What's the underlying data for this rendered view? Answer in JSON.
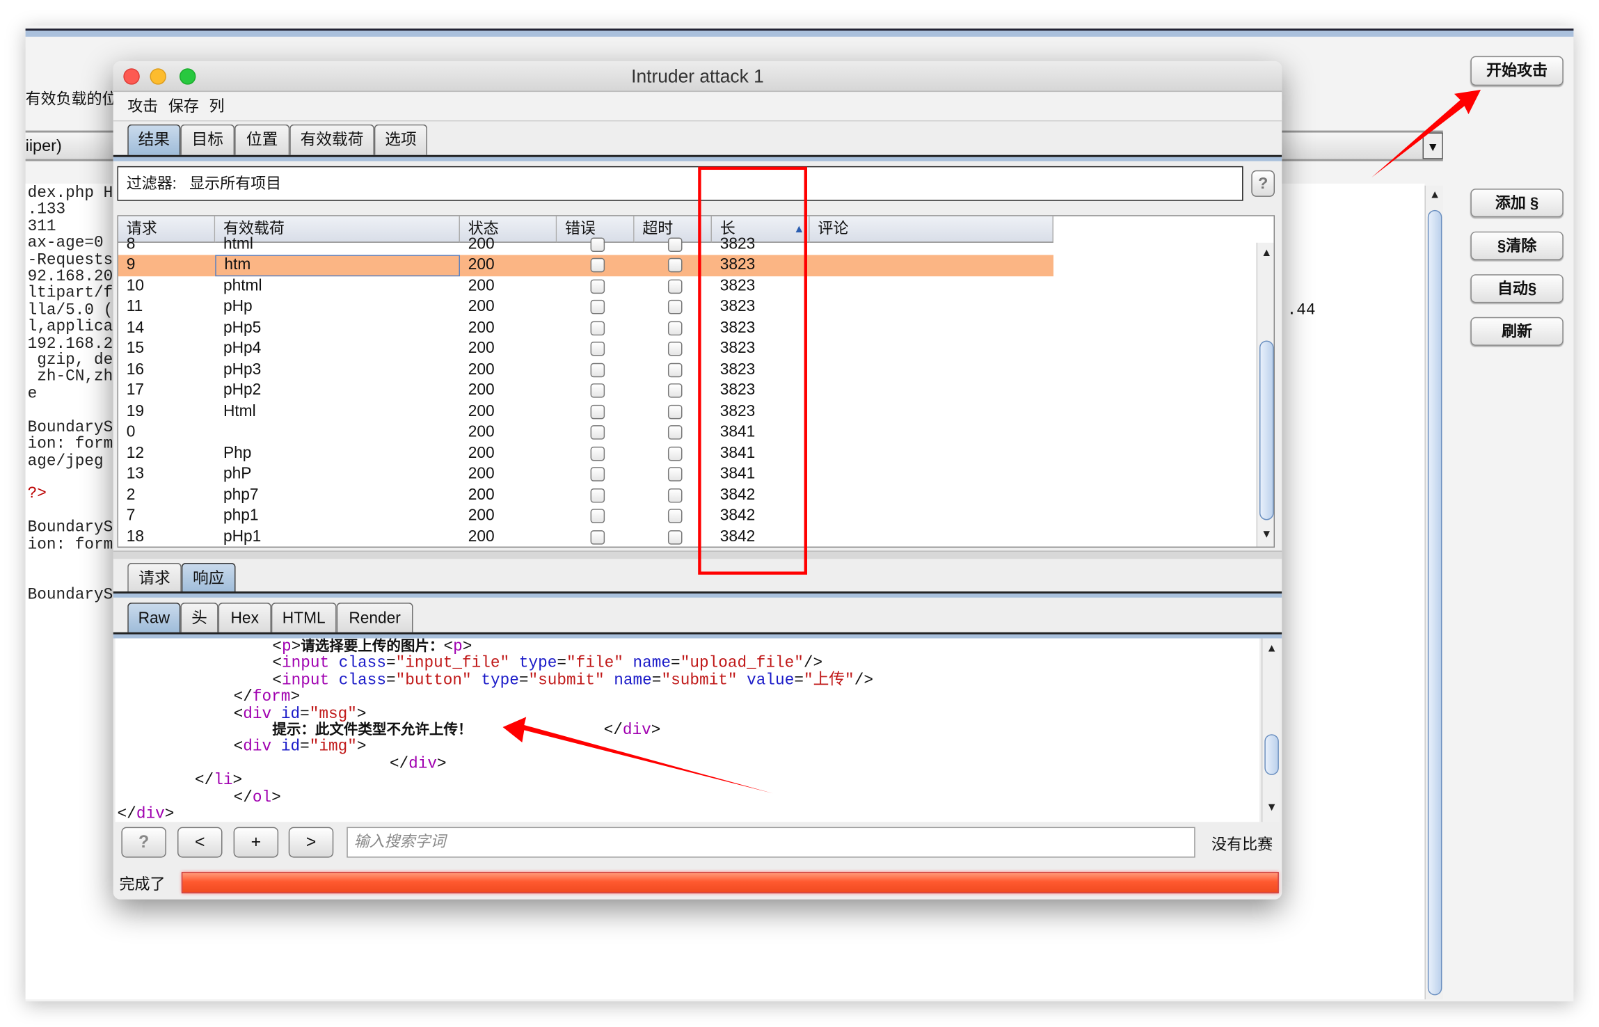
{
  "background": {
    "left_label": "有效负载的位",
    "attack_type_partial": "iiper)",
    "request_lines": [
      "dex.php H",
      ".133",
      "311",
      "ax-age=0",
      "-Requests",
      "92.168.20",
      "ltipart/f",
      "lla/5.0 (",
      "l,applica",
      "192.168.2",
      " gzip, de",
      " zh-CN,zh",
      "e",
      "",
      "BoundaryS",
      "ion: form",
      "age/jpeg",
      "",
      "?>",
      "",
      "BoundaryS",
      "ion: form",
      "",
      "",
      "BoundaryS"
    ],
    "right_partial": ".44",
    "start_attack": "开始攻击",
    "side_buttons": [
      "添加 §",
      "§清除",
      "自动§",
      "刷新"
    ]
  },
  "dialog": {
    "title": "Intruder attack 1",
    "menu": [
      "攻击",
      "保存",
      "列"
    ],
    "tabs": [
      "结果",
      "目标",
      "位置",
      "有效载荷",
      "选项"
    ],
    "selected_tab": "结果",
    "filter_label": "过滤器:",
    "filter_value": "显示所有项目",
    "help_label": "?",
    "columns": [
      "请求",
      "有效载荷",
      "状态",
      "错误",
      "超时",
      "长",
      "评论"
    ],
    "sort_column": "长",
    "sort_icon": "triangle-up",
    "partial_row": [
      "8",
      "html",
      "200",
      "3823"
    ],
    "rows": [
      {
        "req": "9",
        "payload": "htm",
        "status": "200",
        "len": "3823",
        "selected": true
      },
      {
        "req": "10",
        "payload": "phtml",
        "status": "200",
        "len": "3823"
      },
      {
        "req": "11",
        "payload": "pHp",
        "status": "200",
        "len": "3823"
      },
      {
        "req": "14",
        "payload": "pHp5",
        "status": "200",
        "len": "3823"
      },
      {
        "req": "15",
        "payload": "pHp4",
        "status": "200",
        "len": "3823"
      },
      {
        "req": "16",
        "payload": "pHp3",
        "status": "200",
        "len": "3823"
      },
      {
        "req": "17",
        "payload": "pHp2",
        "status": "200",
        "len": "3823"
      },
      {
        "req": "19",
        "payload": "Html",
        "status": "200",
        "len": "3823"
      },
      {
        "req": "0",
        "payload": "",
        "status": "200",
        "len": "3841"
      },
      {
        "req": "12",
        "payload": "Php",
        "status": "200",
        "len": "3841"
      },
      {
        "req": "13",
        "payload": "phP",
        "status": "200",
        "len": "3841"
      },
      {
        "req": "2",
        "payload": "php7",
        "status": "200",
        "len": "3842"
      },
      {
        "req": "7",
        "payload": "php1",
        "status": "200",
        "len": "3842"
      },
      {
        "req": "18",
        "payload": "pHp1",
        "status": "200",
        "len": "3842"
      }
    ],
    "rr_tabs": [
      "请求",
      "响应"
    ],
    "selected_rr_tab": "响应",
    "view_tabs": [
      "Raw",
      "头",
      "Hex",
      "HTML",
      "Render"
    ],
    "selected_view_tab": "Raw",
    "code_lines": [
      [
        [
          "<",
          "p"
        ],
        [
          "p",
          "tag"
        ],
        [
          ">",
          "p"
        ],
        [
          "请选择要上传的图片：",
          "txt"
        ],
        [
          "<",
          "p"
        ],
        [
          "p",
          "tag"
        ],
        [
          ">",
          "p"
        ]
      ],
      [
        [
          "<",
          "p"
        ],
        [
          "input",
          "tag"
        ],
        [
          " ",
          "p"
        ],
        [
          "class",
          "attr"
        ],
        [
          "=",
          "p"
        ],
        [
          "\"input_file\"",
          "val"
        ],
        [
          " ",
          "p"
        ],
        [
          "type",
          "attr"
        ],
        [
          "=",
          "p"
        ],
        [
          "\"file\"",
          "val"
        ],
        [
          " ",
          "p"
        ],
        [
          "name",
          "attr"
        ],
        [
          "=",
          "p"
        ],
        [
          "\"upload_file\"",
          "val"
        ],
        [
          "/>",
          "p"
        ]
      ],
      [
        [
          "<",
          "p"
        ],
        [
          "input",
          "tag"
        ],
        [
          " ",
          "p"
        ],
        [
          "class",
          "attr"
        ],
        [
          "=",
          "p"
        ],
        [
          "\"button\"",
          "val"
        ],
        [
          " ",
          "p"
        ],
        [
          "type",
          "attr"
        ],
        [
          "=",
          "p"
        ],
        [
          "\"submit\"",
          "val"
        ],
        [
          " ",
          "p"
        ],
        [
          "name",
          "attr"
        ],
        [
          "=",
          "p"
        ],
        [
          "\"submit\"",
          "val"
        ],
        [
          " ",
          "p"
        ],
        [
          "value",
          "attr"
        ],
        [
          "=",
          "p"
        ],
        [
          "\"上传\"",
          "val"
        ],
        [
          "/>",
          "p"
        ]
      ],
      [
        [
          "</",
          "p"
        ],
        [
          "form",
          "tag"
        ],
        [
          ">",
          "p"
        ]
      ],
      [
        [
          "<",
          "p"
        ],
        [
          "div",
          "tag"
        ],
        [
          " ",
          "p"
        ],
        [
          "id",
          "attr"
        ],
        [
          "=",
          "p"
        ],
        [
          "\"msg\"",
          "val"
        ],
        [
          ">",
          "p"
        ]
      ],
      [
        [
          "提示：此文件类型不允许上传！",
          "txt"
        ]
      ],
      [
        [
          "<",
          "p"
        ],
        [
          "div",
          "tag"
        ],
        [
          " ",
          "p"
        ],
        [
          "id",
          "attr"
        ],
        [
          "=",
          "p"
        ],
        [
          "\"img\"",
          "val"
        ],
        [
          ">",
          "p"
        ]
      ],
      [
        [
          "</",
          "p"
        ],
        [
          "div",
          "tag"
        ],
        [
          ">",
          "p"
        ]
      ],
      [
        [
          "</",
          "p"
        ],
        [
          "li",
          "tag"
        ],
        [
          ">",
          "p"
        ]
      ],
      [
        [
          "</",
          "p"
        ],
        [
          "ol",
          "tag"
        ],
        [
          ">",
          "p"
        ]
      ],
      [
        [
          "</",
          "p"
        ],
        [
          "div",
          "tag"
        ],
        [
          ">",
          "p"
        ]
      ]
    ],
    "code_extra": [
      [
        "</",
        "p"
      ],
      [
        "div",
        "tag"
      ],
      [
        ">",
        "p"
      ]
    ],
    "search_buttons": [
      "?",
      "<",
      "+",
      ">"
    ],
    "search_placeholder": "输入搜索字词",
    "match_status": "没有比赛",
    "status": "完成了",
    "progress_percent": 100,
    "colors": {
      "selected_row": "#fbb584",
      "tag": "#a000b0",
      "attribute": "#1a1ac8",
      "value": "#c01818",
      "progress": "#ff5a30",
      "annotation": "#ff0000"
    }
  }
}
